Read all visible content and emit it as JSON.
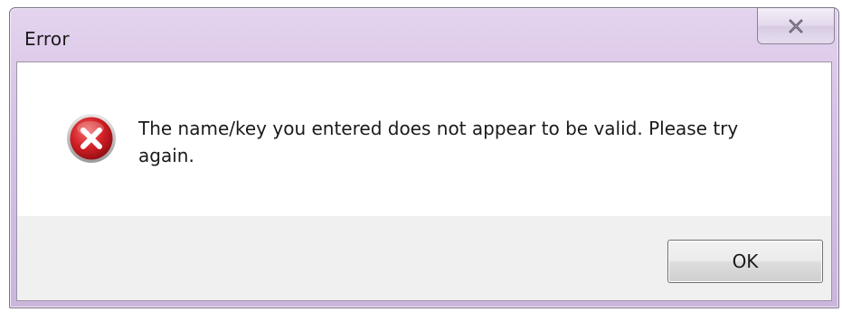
{
  "window": {
    "title": "Error"
  },
  "message": {
    "text": "The name/key you entered does not appear to be valid. Please try again."
  },
  "buttons": {
    "ok_label": "OK"
  },
  "icons": {
    "main": "error-icon",
    "close": "close-icon"
  },
  "colors": {
    "titlebar": "#d7c3e6",
    "error_red": "#c8181e",
    "footer": "#f0f0f0"
  }
}
